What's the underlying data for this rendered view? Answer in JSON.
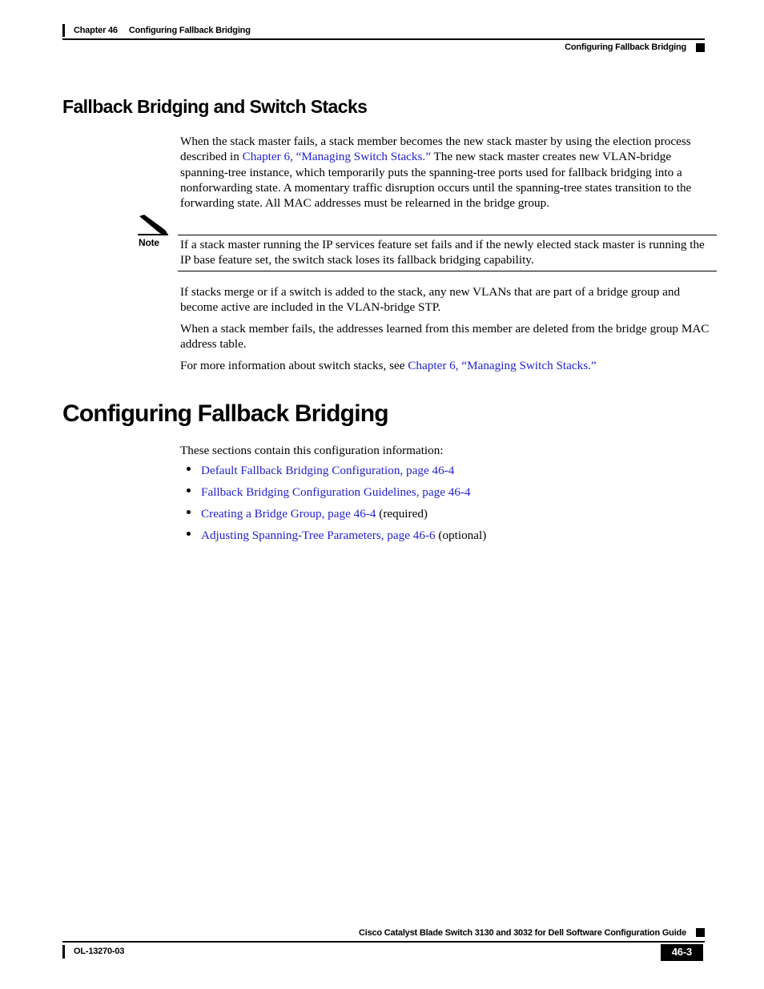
{
  "header": {
    "chapter_label": "Chapter 46",
    "chapter_title": "Configuring Fallback Bridging",
    "running_head": "Configuring Fallback Bridging",
    "marker_icon": "black-square-marker"
  },
  "content": {
    "section_heading": "Fallback Bridging and Switch Stacks",
    "paragraph_1": {
      "part_1": "When the stack master fails, a stack member becomes the new stack master by using the election process described in ",
      "link": "Chapter 6, “Managing Switch Stacks.”",
      "part_2": " The new stack master creates new VLAN-bridge spanning-tree instance, which temporarily puts the spanning-tree ports used for fallback bridging into a nonforwarding state. A momentary traffic disruption occurs until the spanning-tree states transition to the forwarding state. All MAC addresses must be relearned in the bridge group."
    },
    "note": {
      "icon": "pencil-icon",
      "label": "Note",
      "text": "If a stack master running the IP services feature set fails and if the newly elected stack master is running the IP base feature set, the switch stack loses its fallback bridging capability."
    },
    "paragraph_2": "If stacks merge or if a switch is added to the stack, any new VLANs that are part of a bridge group and become active are included in the VLAN-bridge STP.",
    "paragraph_3": "When a stack member fails, the addresses learned from this member are deleted from the bridge group MAC address table.",
    "paragraph_4": {
      "part_1": "For more information about switch stacks, see ",
      "link": "Chapter 6, “Managing Switch Stacks.”"
    },
    "main_heading": "Configuring Fallback Bridging",
    "intro_line": "These sections contain this configuration information:",
    "bullets": [
      {
        "link": "Default Fallback Bridging Configuration, page 46-4",
        "suffix": ""
      },
      {
        "link": "Fallback Bridging Configuration Guidelines, page 46-4",
        "suffix": ""
      },
      {
        "link": "Creating a Bridge Group, page 46-4",
        "suffix": " (required)"
      },
      {
        "link": "Adjusting Spanning-Tree Parameters, page 46-6",
        "suffix": " (optional)"
      }
    ]
  },
  "footer": {
    "doc_title": "Cisco Catalyst Blade Switch 3130 and 3032 for Dell Software Configuration Guide",
    "doc_id": "OL-13270-03",
    "page_number": "46-3",
    "marker_icon": "black-square-marker"
  },
  "colors": {
    "link": "#2222cc",
    "text": "#000000",
    "background": "#ffffff",
    "marker": "#000000"
  }
}
